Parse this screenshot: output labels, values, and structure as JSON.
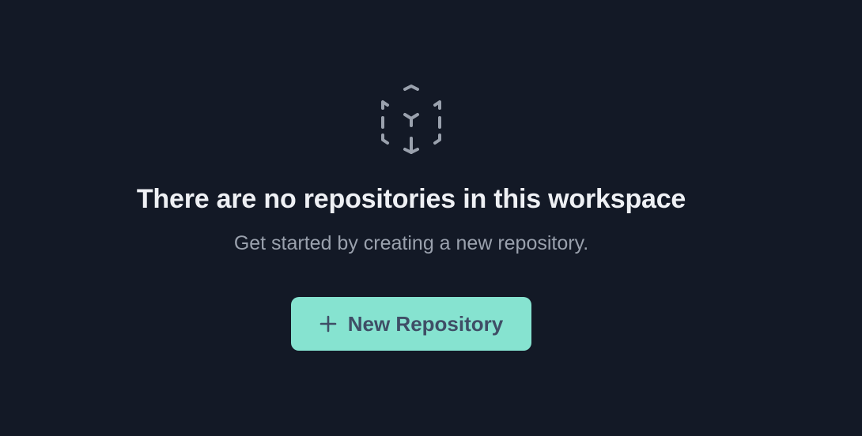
{
  "empty_state": {
    "icon": "cube-outline-icon",
    "title": "There are no repositories in this workspace",
    "subtitle": "Get started by creating a new repository.",
    "button": {
      "icon": "plus-icon",
      "label": "New Repository"
    }
  },
  "colors": {
    "background": "#131926",
    "title": "#eef0f4",
    "subtitle": "#9aa1ad",
    "icon": "#9aa1ad",
    "button_bg": "#86e3d0",
    "button_text": "#3f4e66"
  }
}
